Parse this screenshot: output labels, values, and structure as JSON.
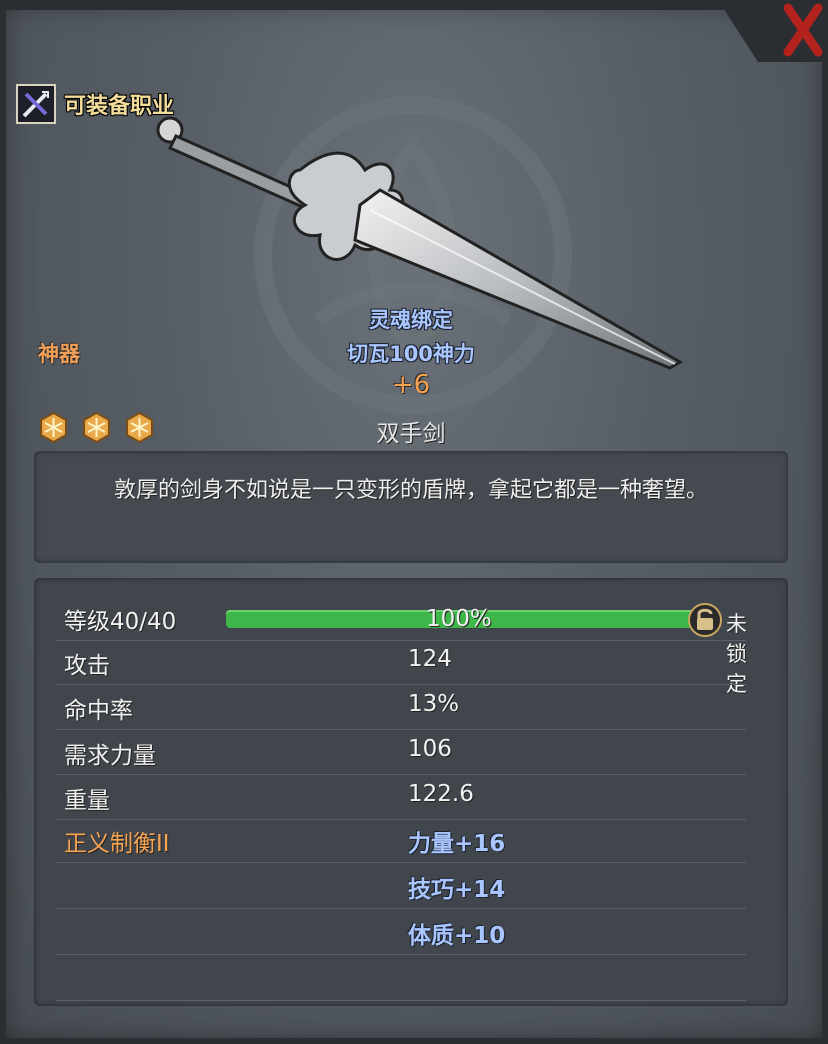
{
  "header": {
    "job_label": "可装备职业"
  },
  "item": {
    "rarity": "神器",
    "bind_status": "灵魂绑定",
    "sub_title": "切瓦100神力",
    "enhance": "+6",
    "type": "双手剑",
    "stars": 3,
    "description": "敦厚的剑身不如说是一只变形的盾牌，拿起它都是一种奢望。"
  },
  "stats": {
    "level_label": "等级40/40",
    "level_percent": "100%",
    "level_progress": 1.0,
    "lock_label": "未锁定",
    "rows": [
      {
        "label": "攻击",
        "value": "124"
      },
      {
        "label": "命中率",
        "value": "13%"
      },
      {
        "label": "需求力量",
        "value": "106"
      },
      {
        "label": "重量",
        "value": "122.6"
      }
    ],
    "set_name": "正义制衡II",
    "set_bonuses": [
      "力量+16",
      "技巧+14",
      "体质+10"
    ]
  },
  "colors": {
    "rarity": "#f1a05a",
    "enhance": "#f6a352",
    "blue_text": "#a9c6ff",
    "bar_fill": "#3fb64a",
    "close_red": "#b3221d"
  },
  "icons": [
    "close-icon",
    "job-class-icon",
    "star-icon",
    "lock-icon",
    "emblem-icon"
  ]
}
